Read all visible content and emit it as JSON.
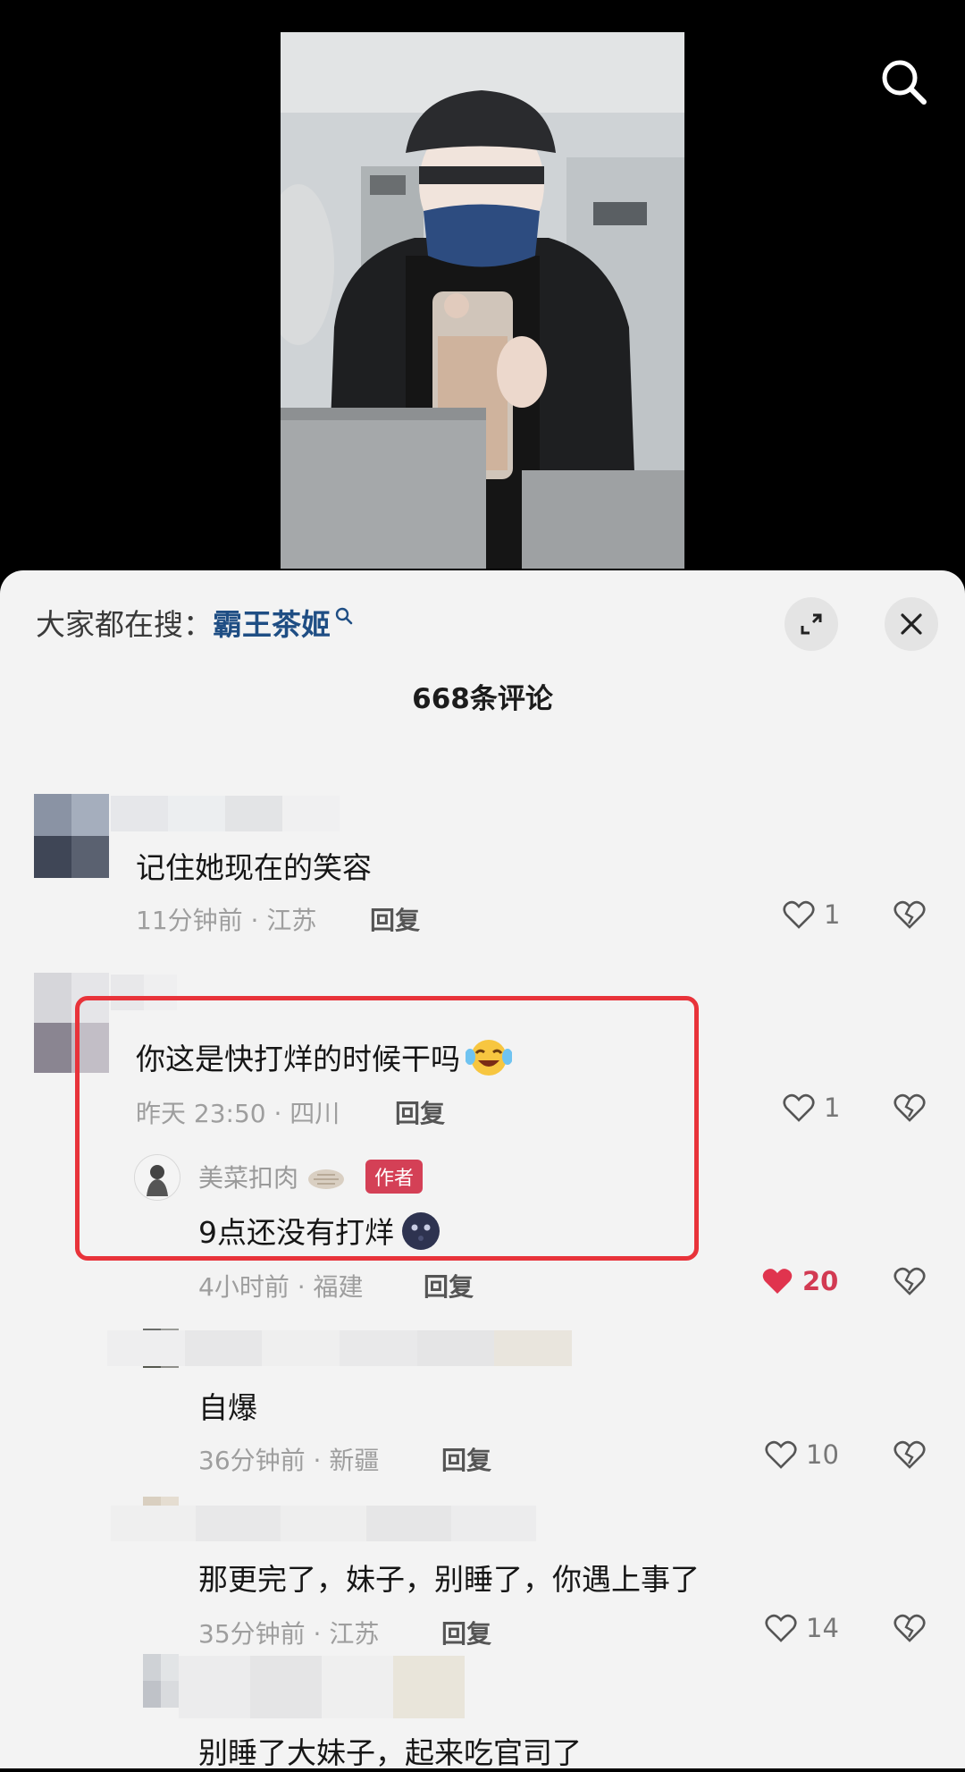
{
  "video": {
    "search_icon": "search-icon"
  },
  "sheet": {
    "hot_search_prefix": "大家都在搜：",
    "hot_search_term": "霸王茶姬",
    "comment_count": "668条评论",
    "expand_icon": "expand-icon",
    "close_icon": "close-icon"
  },
  "comments": [
    {
      "text": "记住她现在的笑容",
      "meta": "11分钟前 · 江苏",
      "reply_label": "回复",
      "likes": "1"
    },
    {
      "text": "你这是快打烊的时候干吗",
      "emoji": "laughing-crying-emoji",
      "meta": "昨天 23:50 · 四川",
      "reply_label": "回复",
      "likes": "1",
      "reply": {
        "author_name": "美菜扣肉",
        "author_badge": "作者",
        "text": "9点还没有打烊",
        "emoji": "moon-face-emoji",
        "meta": "4小时前 · 福建",
        "reply_label": "回复",
        "likes": "20",
        "liked": true
      }
    },
    {
      "text": "自爆",
      "meta": "36分钟前 · 新疆",
      "reply_label": "回复",
      "likes": "10"
    },
    {
      "text": "那更完了，妹子，别睡了，你遇上事了",
      "meta": "35分钟前 · 江苏",
      "reply_label": "回复",
      "likes": "14"
    },
    {
      "text": "别睡了大妹子，起来吃官司了"
    }
  ],
  "colors": {
    "accent_link": "#1f4e84",
    "liked_heart": "#e0344e",
    "highlight_border": "#e8333a",
    "author_badge": "#d44056"
  }
}
